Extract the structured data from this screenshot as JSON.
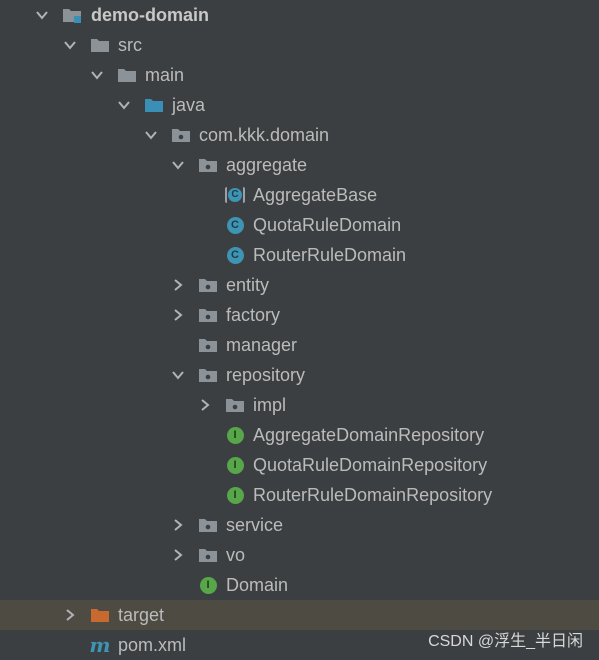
{
  "colors": {
    "background": "#3c3f41",
    "text": "#bbbbbb",
    "highlight_row": "#4e4b43",
    "folder_grey": "#8b9298",
    "folder_blue": "#3a8fb7",
    "folder_orange": "#c86a2f",
    "class_icon": "#3d94b3",
    "interface_icon": "#57a64a",
    "maven_icon": "#3d94b3"
  },
  "tree": [
    {
      "label": "demo-domain",
      "icon": "module-folder-icon",
      "expanded": true
    },
    {
      "label": "src",
      "icon": "folder-icon",
      "expanded": true
    },
    {
      "label": "main",
      "icon": "folder-icon",
      "expanded": true
    },
    {
      "label": "java",
      "icon": "source-root-folder-icon",
      "expanded": true
    },
    {
      "label": "com.kkk.domain",
      "icon": "package-icon",
      "expanded": true
    },
    {
      "label": "aggregate",
      "icon": "package-icon",
      "expanded": true
    },
    {
      "label": "AggregateBase",
      "icon": "abstract-class-icon",
      "icon_letter": "C"
    },
    {
      "label": "QuotaRuleDomain",
      "icon": "class-icon",
      "icon_letter": "C"
    },
    {
      "label": "RouterRuleDomain",
      "icon": "class-icon",
      "icon_letter": "C"
    },
    {
      "label": "entity",
      "icon": "package-icon",
      "expanded": false
    },
    {
      "label": "factory",
      "icon": "package-icon",
      "expanded": false
    },
    {
      "label": "manager",
      "icon": "package-icon"
    },
    {
      "label": "repository",
      "icon": "package-icon",
      "expanded": true
    },
    {
      "label": "impl",
      "icon": "package-icon",
      "expanded": false
    },
    {
      "label": "AggregateDomainRepository",
      "icon": "interface-icon",
      "icon_letter": "I"
    },
    {
      "label": "QuotaRuleDomainRepository",
      "icon": "interface-icon",
      "icon_letter": "I"
    },
    {
      "label": "RouterRuleDomainRepository",
      "icon": "interface-icon",
      "icon_letter": "I"
    },
    {
      "label": "service",
      "icon": "package-icon",
      "expanded": false
    },
    {
      "label": "vo",
      "icon": "package-icon",
      "expanded": false
    },
    {
      "label": "Domain",
      "icon": "interface-icon",
      "icon_letter": "I"
    },
    {
      "label": "target",
      "icon": "excluded-folder-icon",
      "expanded": false
    },
    {
      "label": "pom.xml",
      "icon": "maven-icon",
      "icon_letter": "m"
    }
  ],
  "watermark": "CSDN @浮生_半日闲"
}
